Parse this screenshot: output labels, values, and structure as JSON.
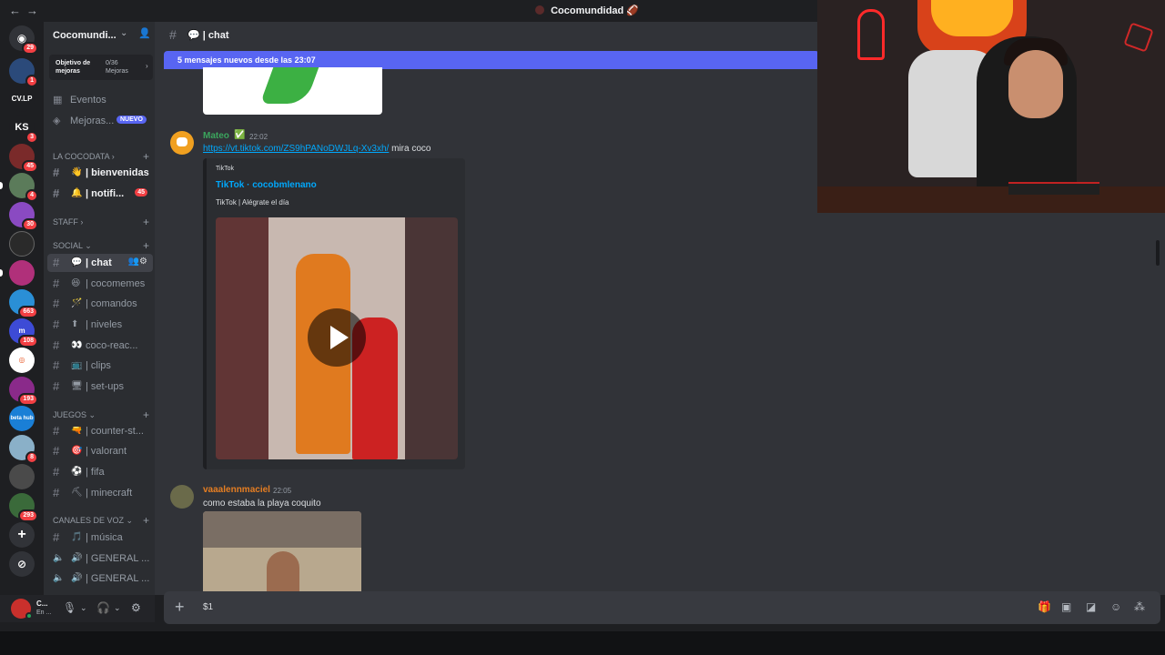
{
  "window": {
    "title": "Cocomundidad",
    "title_emoji": "🏈"
  },
  "server_rail": {
    "servers": [
      {
        "name": "discord-home-icon",
        "badge": "29"
      },
      {
        "name": "server-1",
        "badge": "1"
      },
      {
        "name": "server-cvlp",
        "text": "CV.LP"
      },
      {
        "name": "server-ks",
        "text": "KS",
        "badge": "3"
      },
      {
        "name": "server-4",
        "badge": "45"
      },
      {
        "name": "server-5",
        "badge": "4"
      },
      {
        "name": "server-6",
        "badge": "30"
      },
      {
        "name": "server-7"
      },
      {
        "name": "server-8"
      },
      {
        "name": "server-9",
        "badge": "663"
      },
      {
        "name": "server-10",
        "badge": "108"
      },
      {
        "name": "server-11"
      },
      {
        "name": "server-12",
        "badge": "193"
      },
      {
        "name": "server-betahub",
        "text": "beta hub"
      },
      {
        "name": "server-14",
        "badge": "8"
      },
      {
        "name": "server-15"
      },
      {
        "name": "server-16",
        "badge": "293"
      }
    ]
  },
  "sidebar": {
    "guild_name": "Cocomundi...",
    "boost": {
      "goal_label": "Objetivo de mejoras",
      "count_label": "0/36 Mejoras"
    },
    "events_label": "Eventos",
    "improvements_label": "Mejoras...",
    "new_badge": "NUEVO",
    "categories": {
      "cocodata": "LA COCODATA",
      "staff": "STAFF",
      "social": "SOCIAL",
      "juegos": "JUEGOS",
      "voz": "CANALES DE VOZ"
    },
    "channels": {
      "bienvenidas": "| bienvenidas",
      "notifi": "| notifi...",
      "notifi_badge": "45",
      "chat": "| chat",
      "cocomemes": "| cocomemes",
      "comandos": "| comandos",
      "niveles": "| niveles",
      "cocoreac": "coco-reac...",
      "clips": "| clips",
      "setups": "| set-ups",
      "counter": "| counter-st...",
      "valorant": "| valorant",
      "fifa": "| fifa",
      "minecraft": "| minecraft",
      "musica": "| música",
      "general1": "| GENERAL ...",
      "general2": "| GENERAL ..."
    }
  },
  "user_panel": {
    "name": "C...",
    "status": "En ..."
  },
  "channel_header": {
    "name": "| chat"
  },
  "new_messages_bar": "5 mensajes nuevos desde las 23:07",
  "messages": [
    {
      "author": "Mateo",
      "author_color": "#3ba55d",
      "time": "22:02",
      "link": "https://vt.tiktok.com/ZS9hPANoDWJLq-Xv3xh/",
      "text": " mira coco",
      "embed": {
        "provider": "TikTok",
        "title": "TikTok · cocobmlenano",
        "description": "TikTok | Alégrate el día"
      }
    },
    {
      "author": "vaaalennmaciel",
      "author_color": "#e67e22",
      "time": "22:05",
      "text": "como estaba la playa coquito"
    }
  ],
  "composer": {
    "value": "$1"
  }
}
